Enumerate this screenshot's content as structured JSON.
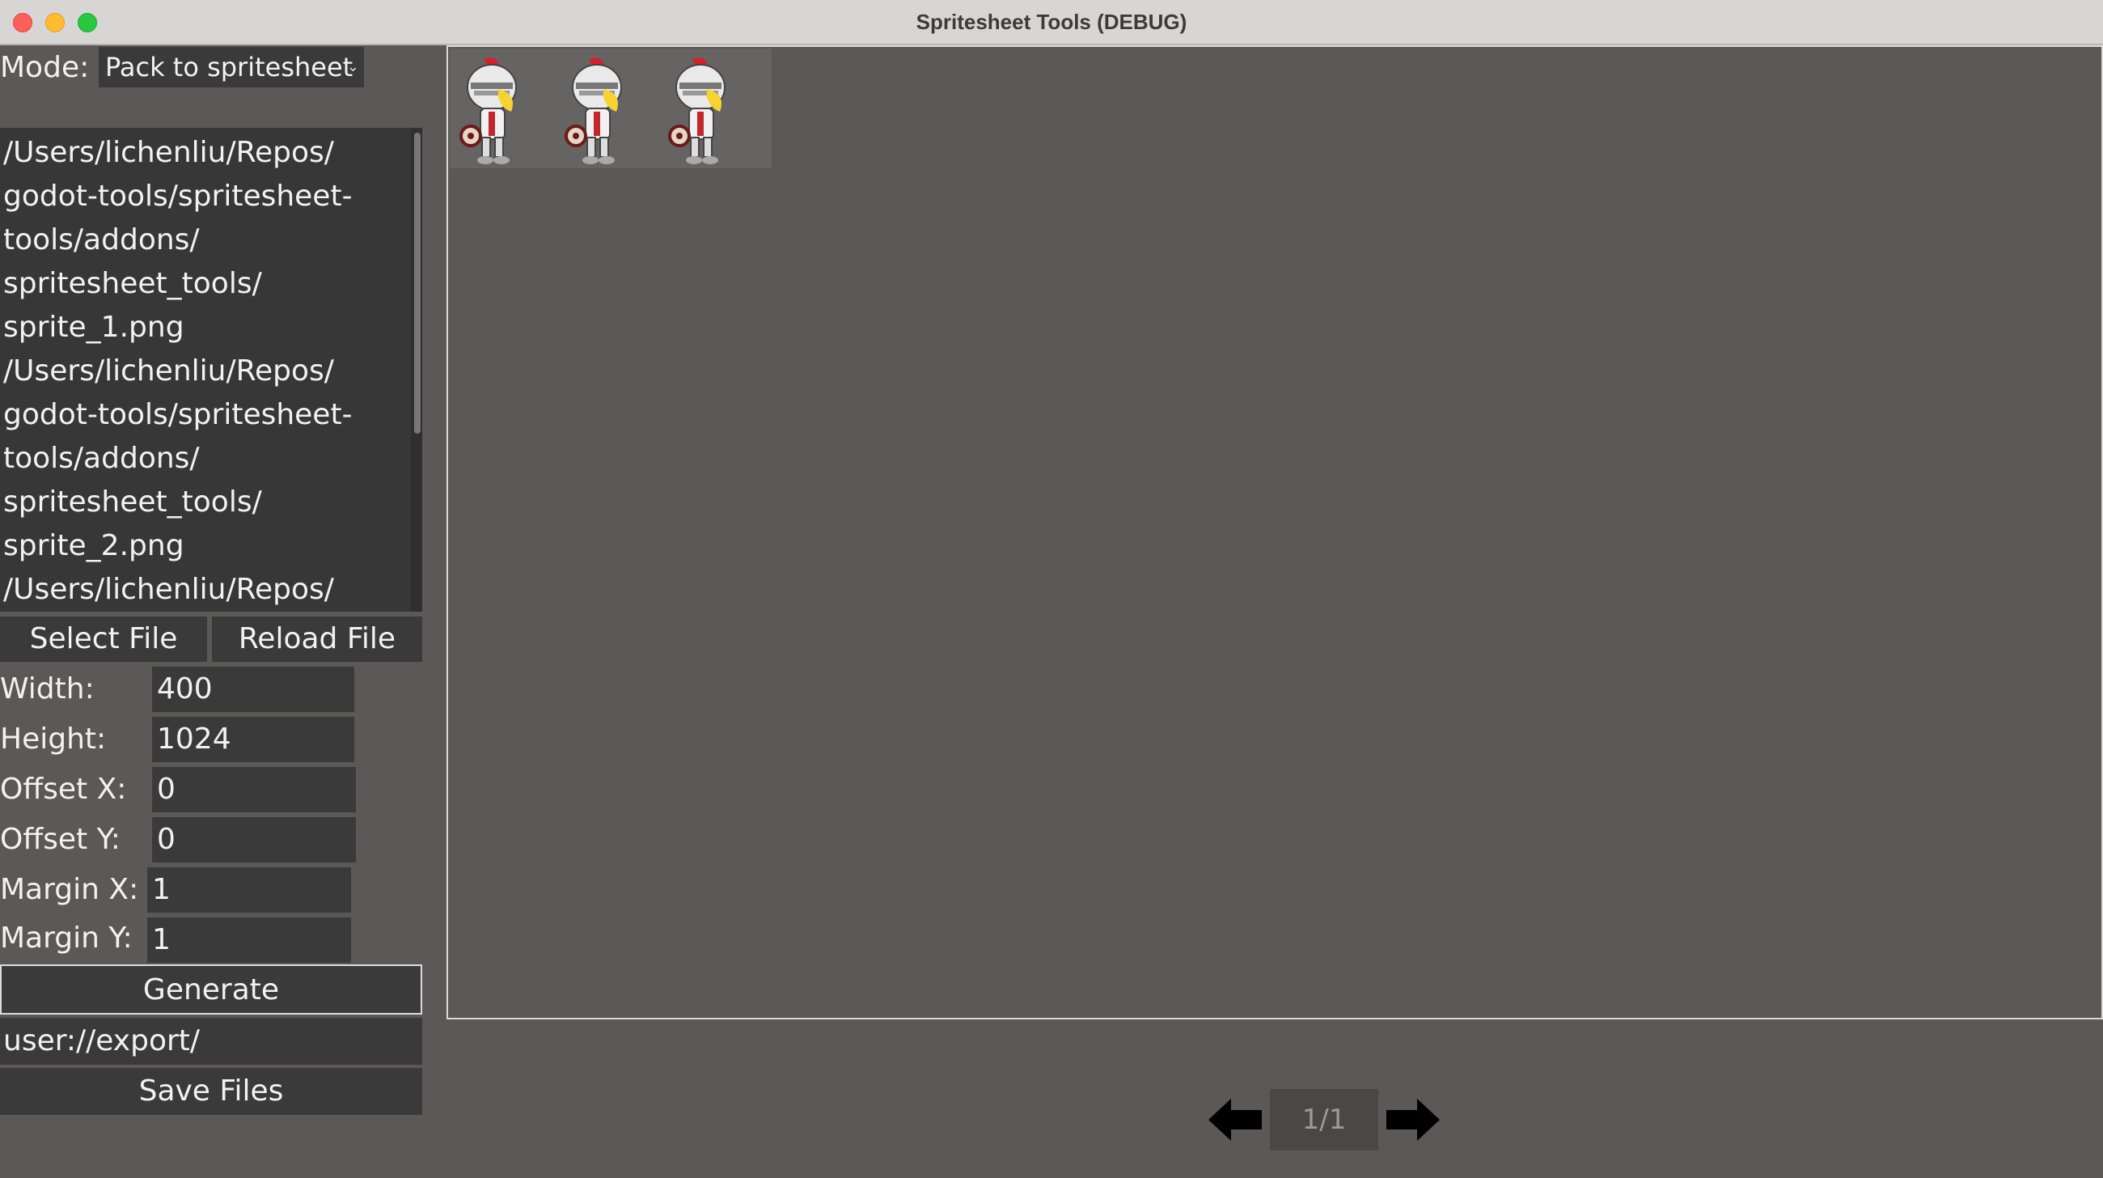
{
  "window": {
    "title": "Spritesheet Tools (DEBUG)"
  },
  "mode": {
    "label": "Mode:",
    "selected": "Pack to spritesheet"
  },
  "file_list": {
    "text": "/Users/lichenliu/Repos/\ngodot-tools/spritesheet-\ntools/addons/\nspritesheet_tools/\nsprite_1.png\n/Users/lichenliu/Repos/\ngodot-tools/spritesheet-\ntools/addons/\nspritesheet_tools/\nsprite_2.png\n/Users/lichenliu/Repos/"
  },
  "buttons": {
    "select_file": "Select File",
    "reload_file": "Reload File",
    "generate": "Generate",
    "save_files": "Save Files"
  },
  "fields": {
    "width": {
      "label": "Width:",
      "value": "400"
    },
    "height": {
      "label": "Height:",
      "value": "1024"
    },
    "offset_x": {
      "label": "Offset X:",
      "value": "0"
    },
    "offset_y": {
      "label": "Offset Y:",
      "value": "0"
    },
    "margin_x": {
      "label": "Margin X:",
      "value": "1"
    },
    "margin_y": {
      "label": "Margin Y:",
      "value": "1"
    }
  },
  "export_path": "user://export/",
  "pager": {
    "label": "1/1"
  },
  "preview": {
    "sprite_count": 3
  },
  "colors": {
    "background": "#5b5857",
    "panel": "#3a3a3a",
    "knight_helmet_plume": "#d5202a",
    "knight_hair": "#f6d331"
  }
}
